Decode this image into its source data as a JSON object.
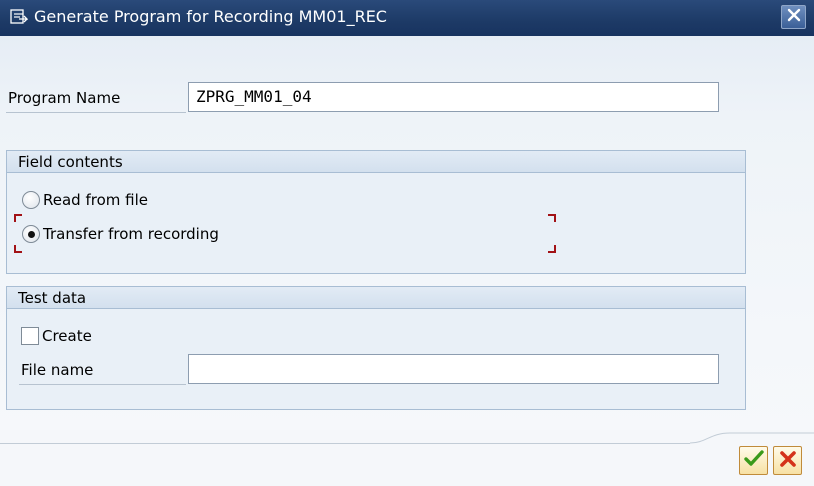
{
  "window": {
    "title": "Generate Program for Recording MM01_REC",
    "title_icon": "program-generate-icon",
    "close_icon": "close-icon"
  },
  "program": {
    "label": "Program Name",
    "value": "ZPRG_MM01_04"
  },
  "field_contents": {
    "title": "Field contents",
    "options": [
      {
        "label": "Read from file",
        "selected": false
      },
      {
        "label": "Transfer from recording",
        "selected": true
      }
    ]
  },
  "test_data": {
    "title": "Test data",
    "create_label": "Create",
    "create_checked": false,
    "file_name_label": "File name",
    "file_name_value": ""
  },
  "footer": {
    "confirm_icon": "checkmark-icon",
    "cancel_icon": "cancel-x-icon"
  },
  "colors": {
    "titlebar": "#1d3a66",
    "focus_marker": "#a21216",
    "confirm": "#3a9a1a",
    "cancel": "#d4321a"
  }
}
